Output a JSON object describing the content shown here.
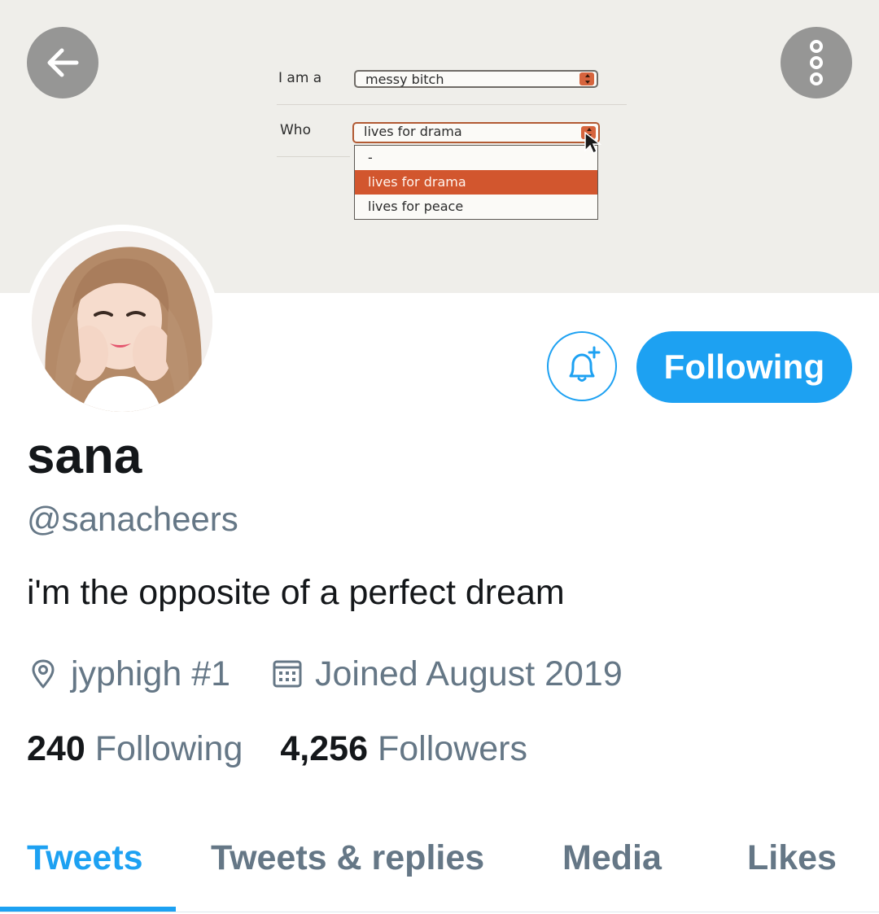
{
  "banner": {
    "row1_label": "I am a",
    "row1_value": "messy bitch",
    "row2_label": "Who",
    "row2_value": "lives for drama",
    "dropdown_options": [
      "-",
      "lives for drama",
      "lives for peace"
    ],
    "selected_option": "lives for drama",
    "accent_color": "#d2562e"
  },
  "nav": {
    "back_icon": "arrow-left-icon",
    "more_icon": "more-vertical-icon"
  },
  "profile": {
    "display_name": "sana",
    "handle": "@sanacheers",
    "bio": "i'm the opposite of a perfect dream",
    "location": "jyphigh #1",
    "joined": "Joined August 2019"
  },
  "actions": {
    "notify_icon": "bell-plus-icon",
    "follow_label": "Following",
    "brand_color": "#1da1f2"
  },
  "stats": {
    "following_count": "240",
    "following_label": "Following",
    "followers_count": "4,256",
    "followers_label": "Followers"
  },
  "tabs": [
    {
      "label": "Tweets",
      "active": true
    },
    {
      "label": "Tweets & replies",
      "active": false
    },
    {
      "label": "Media",
      "active": false
    },
    {
      "label": "Likes",
      "active": false
    }
  ]
}
